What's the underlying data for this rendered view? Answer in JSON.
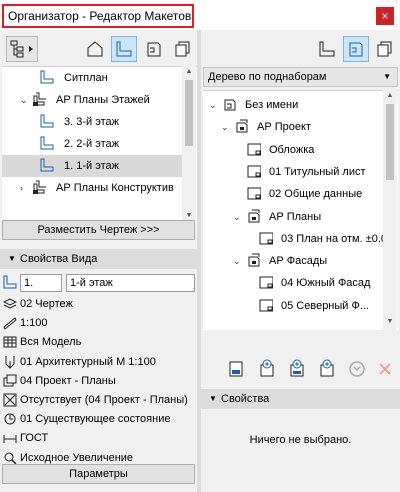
{
  "window": {
    "title": "Организатор - Редактор Макетов",
    "close_glyph": "×"
  },
  "left": {
    "tree": [
      {
        "label": "Ситплан",
        "icon": "layout-icon",
        "indent": 1,
        "expand": ""
      },
      {
        "label": "АР Планы Этажей",
        "icon": "layout-set-icon",
        "indent": 0,
        "expand": "⌄"
      },
      {
        "label": "3. 3-й этаж",
        "icon": "layout-icon",
        "indent": 1,
        "expand": ""
      },
      {
        "label": "2. 2-й этаж",
        "icon": "layout-icon",
        "indent": 1,
        "expand": ""
      },
      {
        "label": "1. 1-й этаж",
        "icon": "layout-icon",
        "indent": 1,
        "expand": "",
        "selected": true
      },
      {
        "label": "АР Планы Конструктив",
        "icon": "layout-set-icon",
        "indent": 0,
        "expand": "›"
      }
    ],
    "place_button": "Разместить Чертеж >>>",
    "view_props_title": "Свойства Вида",
    "id_field": "1.",
    "name_field": "1-й этаж",
    "props": [
      {
        "icon": "layers-icon",
        "text": "02 Чертеж"
      },
      {
        "icon": "scale-icon",
        "text": "1:100"
      },
      {
        "icon": "model-icon",
        "text": "Вся Модель"
      },
      {
        "icon": "pen-icon",
        "text": "01 Архитектурный М 1:100"
      },
      {
        "icon": "combination-icon",
        "text": "04 Проект - Планы"
      },
      {
        "icon": "override-icon",
        "text": "Отсутствует (04 Проект - Планы)"
      },
      {
        "icon": "renovation-icon",
        "text": "01 Существующее состояние"
      },
      {
        "icon": "dimension-icon",
        "text": "ГОСТ"
      },
      {
        "icon": "zoom-icon",
        "text": "Исходное Увеличение"
      }
    ],
    "params_button": "Параметры"
  },
  "right": {
    "dropdown": "Дерево по поднаборам",
    "tree": [
      {
        "label": "Без имени",
        "icon": "book-icon",
        "indent": 0,
        "expand": "⌄"
      },
      {
        "label": "АР Проект",
        "icon": "subset-icon",
        "indent": 1,
        "expand": "⌄"
      },
      {
        "label": "Обложка",
        "icon": "sheet-icon",
        "indent": 2,
        "expand": ""
      },
      {
        "label": "01 Титульный лист",
        "icon": "sheet-icon",
        "indent": 2,
        "expand": ""
      },
      {
        "label": "02 Общие данные",
        "icon": "sheet-icon",
        "indent": 2,
        "expand": ""
      },
      {
        "label": "АР Планы",
        "icon": "subset-icon",
        "indent": 2,
        "expand": "⌄"
      },
      {
        "label": "03 План на отм. ±0.0",
        "icon": "sheet-icon",
        "indent": 3,
        "expand": ""
      },
      {
        "label": "АР Фасады",
        "icon": "subset-icon",
        "indent": 2,
        "expand": "⌄"
      },
      {
        "label": "04 Южный Фасад",
        "icon": "sheet-icon",
        "indent": 3,
        "expand": ""
      },
      {
        "label": "05 Северный Ф...",
        "icon": "sheet-icon",
        "indent": 3,
        "expand": ""
      }
    ],
    "props_title": "Свойства",
    "no_selection": "Ничего не выбрано."
  }
}
